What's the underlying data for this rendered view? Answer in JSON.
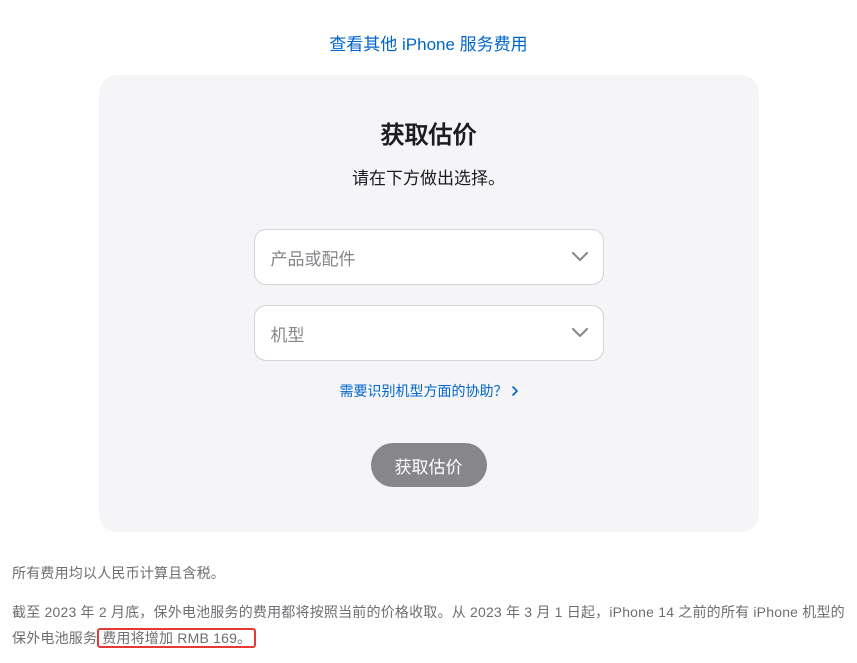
{
  "topLink": {
    "label": "查看其他 iPhone 服务费用"
  },
  "card": {
    "title": "获取估价",
    "subtitle": "请在下方做出选择。",
    "productSelect": {
      "placeholder": "产品或配件"
    },
    "modelSelect": {
      "placeholder": "机型"
    },
    "helpLink": {
      "label": "需要识别机型方面的协助？"
    },
    "button": {
      "label": "获取估价"
    }
  },
  "footer": {
    "note1": "所有费用均以人民币计算且含税。",
    "note2_prefix": "截至 2023 年 2 月底，保外电池服务的费用都将按照当前的价格收取。从 2023 年 3 月 1 日起，iPhone 14 之前的所有 iPhone 机型的保外电池服务",
    "note2_highlight": "费用将增加 RMB 169。"
  }
}
